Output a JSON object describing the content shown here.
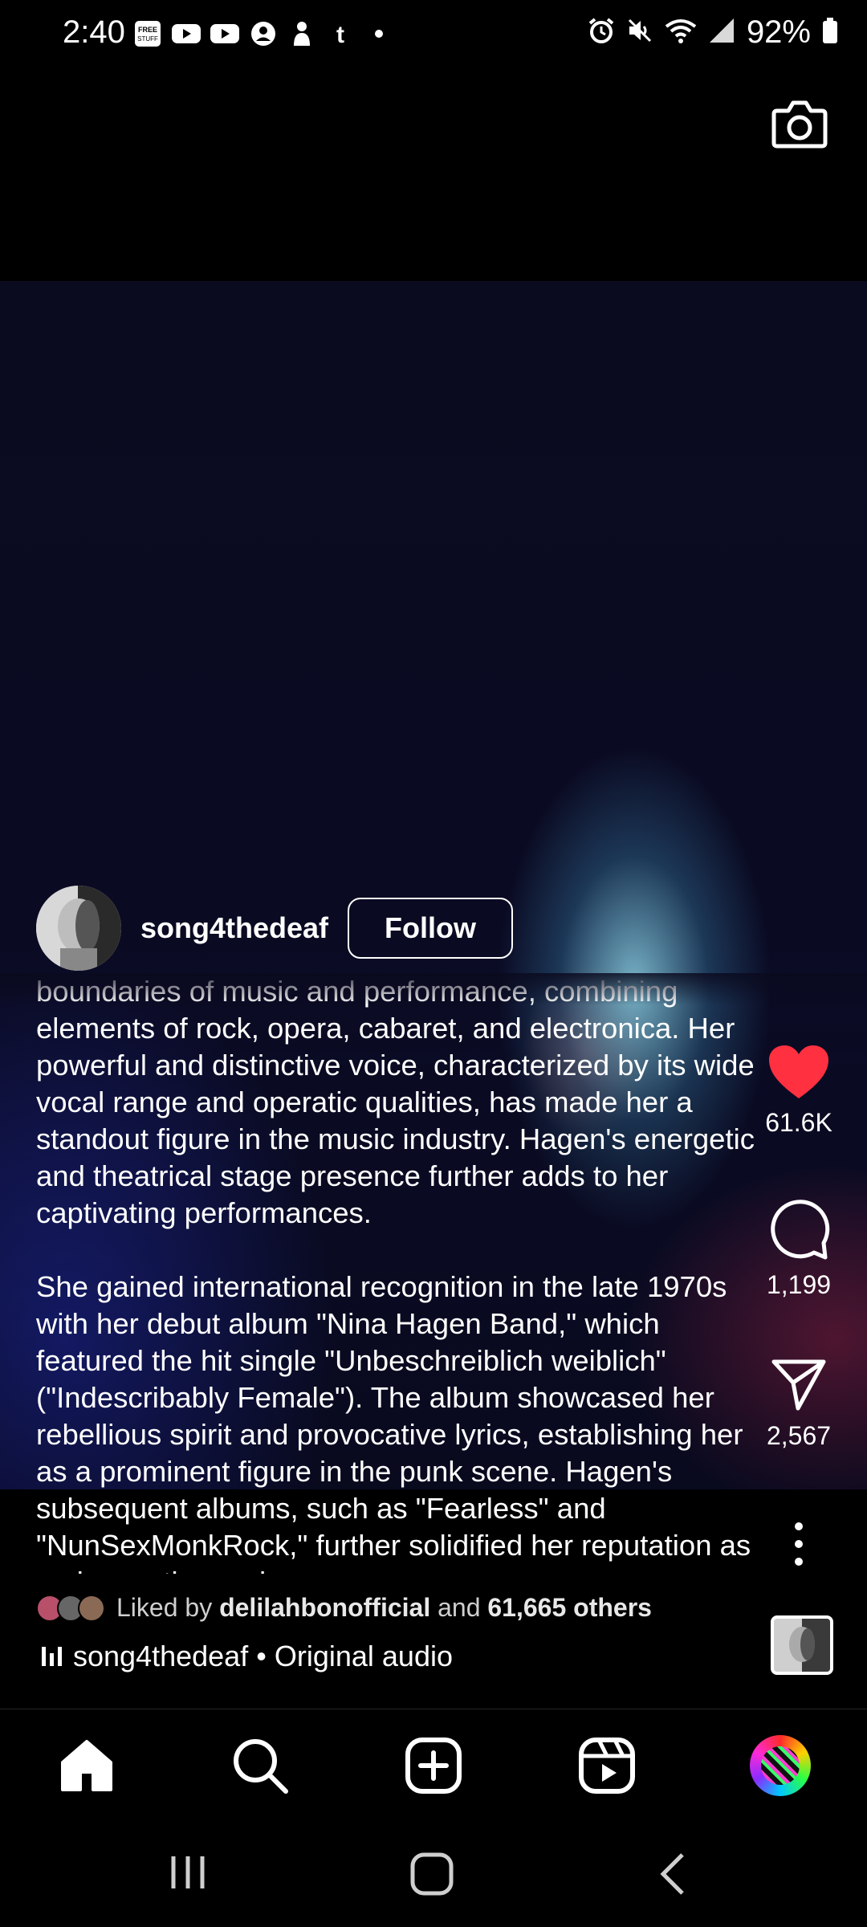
{
  "status_bar": {
    "time": "2:40",
    "left_icons": [
      "free-stuff-icon",
      "youtube-icon",
      "youtube-icon",
      "account-icon",
      "thumbs-icon",
      "tumblr-icon",
      "dot-icon"
    ],
    "right_icons": [
      "alarm-icon",
      "mute-icon",
      "wifi-icon",
      "signal-icon",
      "battery-icon"
    ],
    "battery": "92%"
  },
  "post": {
    "username": "song4thedeaf",
    "follow_label": "Follow",
    "caption_paragraphs": [
      "boundaries of music and performance, combining elements of rock, opera, cabaret, and electronica. Her powerful and distinctive voice, characterized by its wide vocal range and operatic qualities, has made her a standout figure in the music industry. Hagen's energetic and theatrical stage presence further adds to her captivating performances.",
      "She gained international recognition in the late 1970s with her debut album \"Nina Hagen Band,\" which featured the hit single \"Unbeschreiblich weiblich\" (\"Indescribably Female\"). The album showcased her rebellious spirit and provocative lyrics, establishing her as a prominent figure in the punk scene. Hagen's subsequent albums, such as \"Fearless\" and \"NunSexMonkRock,\" further solidified her reputation as an innovative and"
    ],
    "likes": {
      "prefix": "Liked by",
      "user": "delilahbonofficial",
      "middle": "and",
      "others": "61,665 others"
    },
    "audio": {
      "artist": "song4thedeaf",
      "separator": "•",
      "title": "Original audio"
    }
  },
  "actions": {
    "like_count": "61.6K",
    "comment_count": "1,199",
    "share_count": "2,567",
    "like_color": "#ff3040"
  },
  "nav": {
    "items": [
      "home-icon",
      "search-icon",
      "create-icon",
      "reels-icon",
      "profile-avatar"
    ]
  }
}
